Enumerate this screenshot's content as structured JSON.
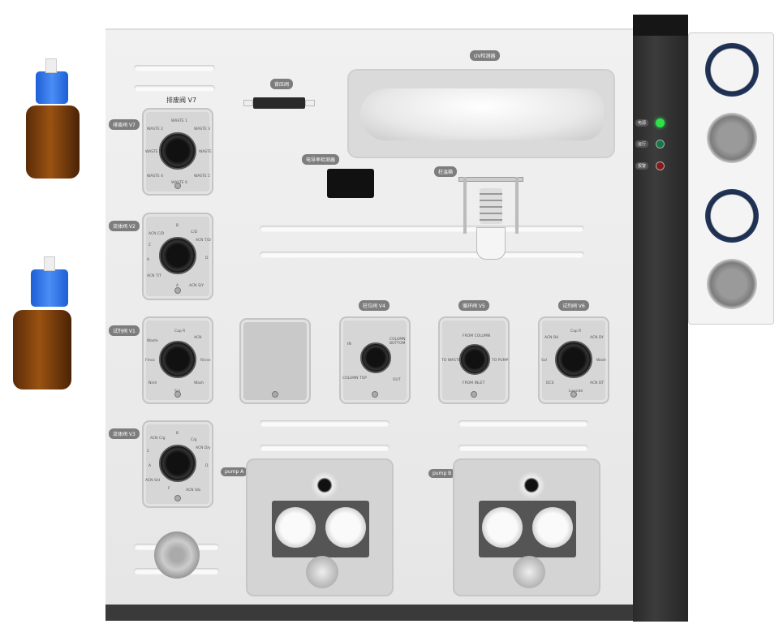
{
  "labels": {
    "uv_detector": "UV检测器",
    "back_pressure_valve": "背压阀",
    "conductivity_detector": "电导率检测器",
    "column_oven": "柱温箱",
    "pump_a": "pump A",
    "pump_b": "pump B"
  },
  "indicators": [
    {
      "label": "电源",
      "color": "#2ee04a"
    },
    {
      "label": "运行",
      "color": "#0f7a4a"
    },
    {
      "label": "报警",
      "color": "#8a1a1a"
    }
  ],
  "valves": {
    "v7": {
      "title": "排废阀 V7",
      "side_label": "排废阀 V7",
      "ports": [
        "WASTE 1",
        "WASTE 2",
        "WASTE 3",
        "WASTE",
        "WASTE",
        "WASTE 4",
        "WASTE 5",
        "WASTE 6"
      ]
    },
    "v2": {
      "label": "流体阀 V2",
      "ports": [
        "B",
        "ACN C/D",
        "C/D",
        "ACN T/D",
        "C",
        "D",
        "A",
        "ACN T/T",
        "A",
        "ACN S/Y"
      ]
    },
    "v1": {
      "label": "试剂阀 V1",
      "ports": [
        "Cap R",
        "ACN",
        "Waste",
        "Fmoc",
        "Rinse",
        "Wash",
        "Ninh",
        "Sol"
      ]
    },
    "v3": {
      "label": "流体阀 V3",
      "ports": [
        "B",
        "ACN C/g",
        "C/g",
        "ACN D/y",
        "C",
        "D",
        "ACN S/d",
        "ACN S/b",
        "A",
        "F"
      ]
    },
    "v4": {
      "label": "柱位阀 V4",
      "ports": [
        "IN",
        "COLUMN BOTTOM",
        "COLUMN TOP",
        "OUT"
      ]
    },
    "v5": {
      "label": "循环阀 V5",
      "ports": [
        "FROM COLUMN",
        "TO WASTE",
        "TO PUMP",
        "FROM INLET"
      ]
    },
    "v6": {
      "label": "试剂阀 V6",
      "ports": [
        "Cap R",
        "ACN BU",
        "ACN DY",
        "Sol",
        "Wash",
        "DCS",
        "ACN DT",
        "Lonside"
      ]
    }
  }
}
